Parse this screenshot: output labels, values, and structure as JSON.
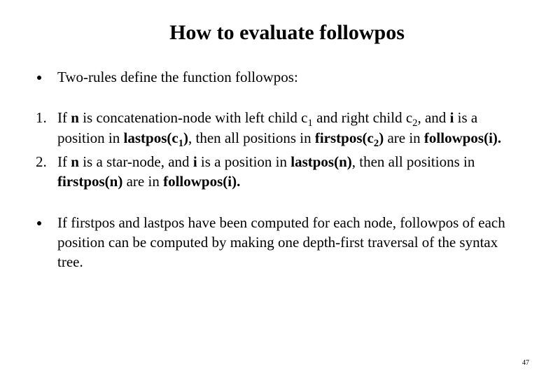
{
  "title": "How to evaluate  followpos",
  "intro": "Two-rules define the function followpos:",
  "rule1": {
    "p1": "If ",
    "n": "n",
    "p2": " is concatenation-node with left child c",
    "s1": "1",
    "p3": " and right child c",
    "s2": "2",
    "p4": ", and ",
    "i": "i",
    "p5": " is a position in ",
    "lp": "lastpos(c",
    "lpe": ")",
    "p6": ", then all positions in ",
    "fp": "firstpos(c",
    "fpe": ")",
    "p7": " are in ",
    "flw": "followpos(i).",
    "p8": ""
  },
  "rule2": {
    "p1": "If ",
    "n": "n",
    "p2": " is a star-node, and ",
    "i": "i",
    "p3": " is a position in ",
    "lp": "lastpos(n)",
    "p4": ", then all positions in ",
    "fp": "firstpos(n)",
    "p5": " are in ",
    "flw": "followpos(i).",
    "p6": ""
  },
  "conclusion": "If firstpos and lastpos have been computed for each node, followpos of each position can be computed by making one depth-first traversal of the syntax tree.",
  "page": "47"
}
